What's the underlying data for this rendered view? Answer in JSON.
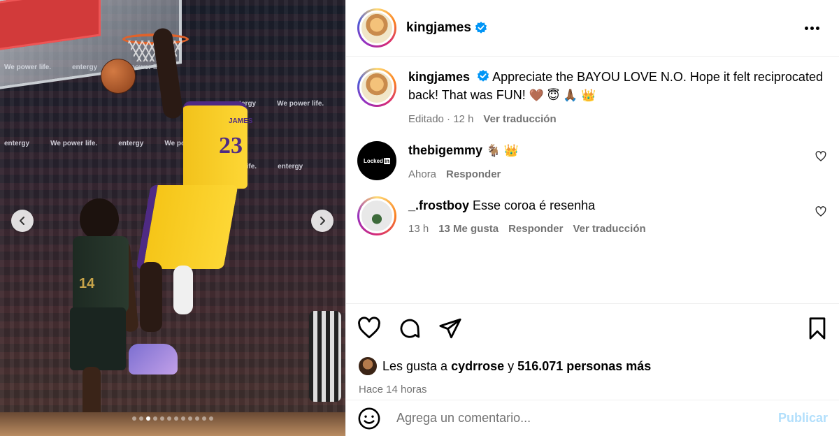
{
  "post": {
    "username": "kingjames",
    "caption": "Appreciate the BAYOU LOVE N.O. Hope it felt reciprocated back! That was FUN!",
    "caption_emojis": "🤎 😇 🙏🏾 👑",
    "caption_meta": {
      "edited": "Editado",
      "time": "12 h",
      "translate": "Ver traducción"
    }
  },
  "media": {
    "boards": [
      "We power life.",
      "entergy",
      "We power life.",
      "entergy"
    ],
    "jersey_number": "23",
    "jersey_name": "JAMES",
    "opponent_number": "14",
    "carousel": {
      "count": 12,
      "active_index": 2
    }
  },
  "comments": [
    {
      "username": "thebigemmy",
      "text": "🐐 👑",
      "time": "Ahora",
      "likes": "",
      "reply": "Responder",
      "translate": ""
    },
    {
      "username": "_.frostboy",
      "text": "Esse coroa é resenha",
      "time": "13 h",
      "likes": "13 Me gusta",
      "reply": "Responder",
      "translate": "Ver traducción"
    }
  ],
  "locked_logo": {
    "text": "Locked",
    "suffix": "in"
  },
  "likes": {
    "prefix": "Les gusta a",
    "user": "cydrrose",
    "joiner": "y",
    "count": "516.071 personas más"
  },
  "posted_time": "Hace 14 horas",
  "add_comment": {
    "placeholder": "Agrega un comentario...",
    "publish": "Publicar"
  },
  "colors": {
    "verified": "#0095f6",
    "publish_disabled": "#b2dffc",
    "meta": "#737373"
  }
}
